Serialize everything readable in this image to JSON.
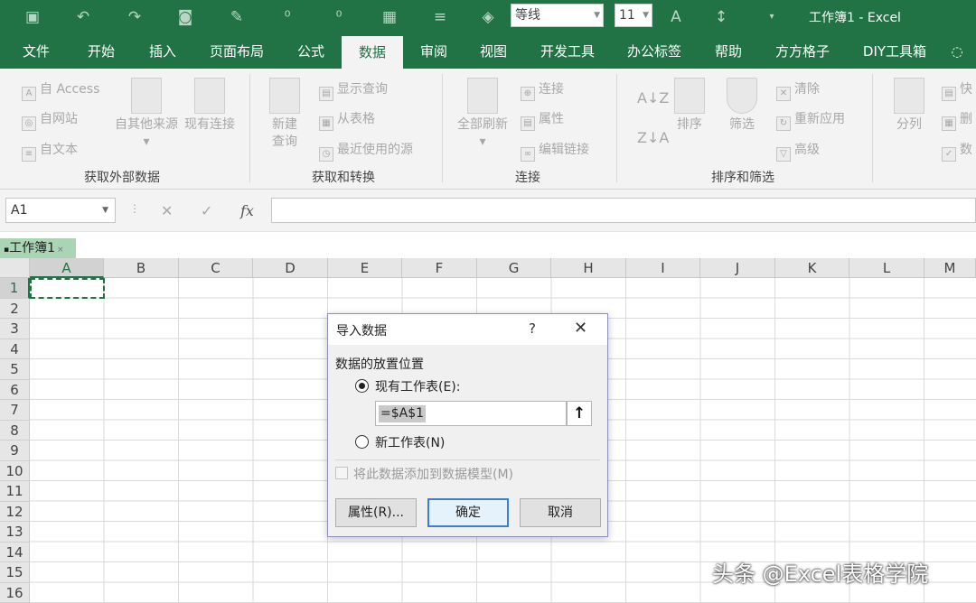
{
  "quick_access": {
    "font_name": "等线",
    "font_size": "11",
    "window_title": "工作簿1 - Excel"
  },
  "tabs": [
    "文件",
    "开始",
    "插入",
    "页面布局",
    "公式",
    "数据",
    "审阅",
    "视图",
    "开发工具",
    "办公标签",
    "帮助",
    "方方格子",
    "DIY工具箱"
  ],
  "ribbon": {
    "get_external": {
      "label": "获取外部数据",
      "from_access": "自 Access",
      "from_web": "自网站",
      "from_text": "自文本",
      "from_other": "自其他来源",
      "existing": "现有连接"
    },
    "transform": {
      "label": "获取和转换",
      "new_query_1": "新建",
      "new_query_2": "查询",
      "show_queries": "显示查询",
      "from_table": "从表格",
      "recent": "最近使用的源"
    },
    "connections": {
      "label": "连接",
      "refresh": "全部刷新",
      "connections": "连接",
      "properties": "属性",
      "edit_links": "编辑链接"
    },
    "sort_filter": {
      "label": "排序和筛选",
      "sort": "排序",
      "filter": "筛选",
      "clear": "清除",
      "reapply": "重新应用",
      "advanced": "高级"
    },
    "tools": {
      "split": "分列",
      "more1": "快",
      "more2": "删",
      "more3": "数"
    }
  },
  "formula_bar": {
    "name_box": "A1",
    "fx": "fx",
    "formula": ""
  },
  "sheet_tab": {
    "workbook": "工作簿1",
    "close": "×"
  },
  "columns": [
    "A",
    "B",
    "C",
    "D",
    "E",
    "F",
    "G",
    "H",
    "I",
    "J",
    "K",
    "L",
    "M"
  ],
  "rows": [
    "1",
    "2",
    "3",
    "4",
    "5",
    "6",
    "7",
    "8",
    "9",
    "10",
    "11",
    "12",
    "13",
    "14",
    "15",
    "16"
  ],
  "dialog": {
    "title": "导入数据",
    "help": "?",
    "close": "✕",
    "section_label": "数据的放置位置",
    "existing_sheet": "现有工作表(E):",
    "reference": "=$A$1",
    "new_sheet": "新工作表(N)",
    "add_model": "将此数据添加到数据模型(M)",
    "properties_btn": "属性(R)...",
    "ok_btn": "确定",
    "cancel_btn": "取消"
  },
  "watermark": "头条 @Excel表格学院"
}
